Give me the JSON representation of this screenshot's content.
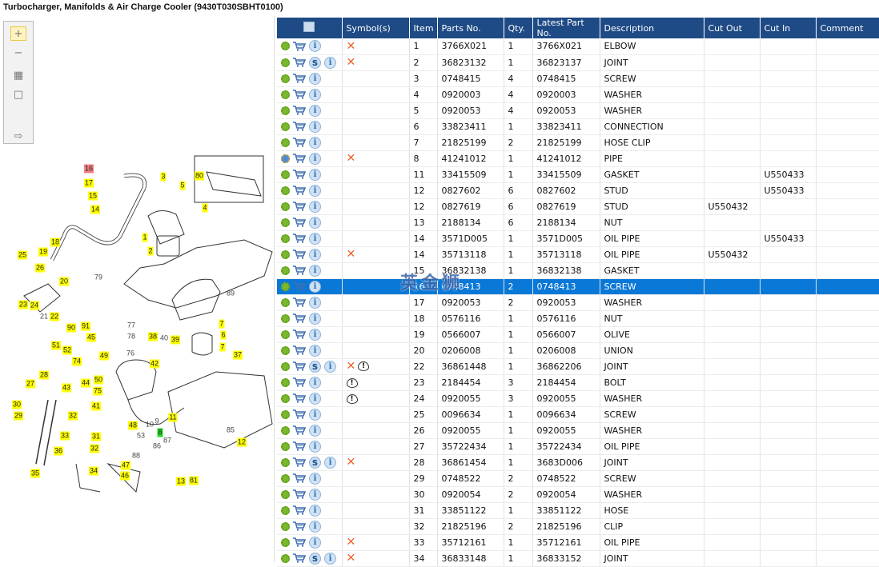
{
  "window": {
    "title": "Turbocharger, Manifolds & Air Charge Cooler (9430T030SBHT0100)"
  },
  "toolbar": {
    "icons": [
      "zoom-in-icon",
      "zoom-out-icon",
      "fit-page-icon",
      "actual-size-icon",
      "toggle-panel-icon"
    ]
  },
  "diagram": {
    "callouts": [
      {
        "t": "16",
        "s": "r"
      },
      {
        "t": "17",
        "s": "y"
      },
      {
        "t": "15",
        "s": "y"
      },
      {
        "t": "14",
        "s": "y"
      },
      {
        "t": "3",
        "s": "y"
      },
      {
        "t": "5",
        "s": "y"
      },
      {
        "t": "4",
        "s": "y"
      },
      {
        "t": "80",
        "s": "y"
      },
      {
        "t": "1",
        "s": "y"
      },
      {
        "t": "2",
        "s": "y"
      },
      {
        "t": "18",
        "s": "y"
      },
      {
        "t": "19",
        "s": "y"
      },
      {
        "t": "25",
        "s": "y"
      },
      {
        "t": "26",
        "s": "y"
      },
      {
        "t": "20",
        "s": "y"
      },
      {
        "t": "79",
        "s": "n"
      },
      {
        "t": "23",
        "s": "y"
      },
      {
        "t": "24",
        "s": "y"
      },
      {
        "t": "21",
        "s": "n"
      },
      {
        "t": "22",
        "s": "y"
      },
      {
        "t": "89",
        "s": "n"
      },
      {
        "t": "90",
        "s": "y"
      },
      {
        "t": "91",
        "s": "y"
      },
      {
        "t": "77",
        "s": "n"
      },
      {
        "t": "78",
        "s": "n"
      },
      {
        "t": "76",
        "s": "n"
      },
      {
        "t": "38",
        "s": "y"
      },
      {
        "t": "40",
        "s": "n"
      },
      {
        "t": "39",
        "s": "y"
      },
      {
        "t": "7",
        "s": "y"
      },
      {
        "t": "6",
        "s": "y"
      },
      {
        "t": "7",
        "s": "y"
      },
      {
        "t": "37",
        "s": "y"
      },
      {
        "t": "51",
        "s": "y"
      },
      {
        "t": "52",
        "s": "y"
      },
      {
        "t": "45",
        "s": "y"
      },
      {
        "t": "74",
        "s": "y"
      },
      {
        "t": "49",
        "s": "y"
      },
      {
        "t": "42",
        "s": "y"
      },
      {
        "t": "28",
        "s": "y"
      },
      {
        "t": "27",
        "s": "y"
      },
      {
        "t": "50",
        "s": "y"
      },
      {
        "t": "44",
        "s": "y"
      },
      {
        "t": "43",
        "s": "y"
      },
      {
        "t": "75",
        "s": "y"
      },
      {
        "t": "30",
        "s": "y"
      },
      {
        "t": "41",
        "s": "y"
      },
      {
        "t": "29",
        "s": "y"
      },
      {
        "t": "11",
        "s": "y"
      },
      {
        "t": "10",
        "s": "n"
      },
      {
        "t": "9",
        "s": "n"
      },
      {
        "t": "48",
        "s": "y"
      },
      {
        "t": "8",
        "s": "g"
      },
      {
        "t": "32",
        "s": "y"
      },
      {
        "t": "31",
        "s": "y"
      },
      {
        "t": "53",
        "s": "n"
      },
      {
        "t": "85",
        "s": "n"
      },
      {
        "t": "87",
        "s": "n"
      },
      {
        "t": "33",
        "s": "y"
      },
      {
        "t": "32",
        "s": "y"
      },
      {
        "t": "86",
        "s": "n"
      },
      {
        "t": "12",
        "s": "y"
      },
      {
        "t": "88",
        "s": "n"
      },
      {
        "t": "36",
        "s": "y"
      },
      {
        "t": "47",
        "s": "y"
      },
      {
        "t": "46",
        "s": "y"
      },
      {
        "t": "35",
        "s": "y"
      },
      {
        "t": "34",
        "s": "y"
      },
      {
        "t": "13",
        "s": "y"
      },
      {
        "t": "81",
        "s": "y"
      }
    ]
  },
  "table": {
    "columns": [
      "",
      "Symbol(s)",
      "Item",
      "Parts No.",
      "Qty.",
      "Latest Part No.",
      "Description",
      "Cut Out",
      "Cut In",
      "Comment"
    ],
    "header_icon": "search-list-icon",
    "selected_row": 15,
    "watermark": "英金狮",
    "rows": [
      {
        "item": "1",
        "part": "3766X021",
        "qty": "1",
        "latest": "3766X021",
        "desc": "ELBOW",
        "out": "",
        "in": "",
        "s": false,
        "x": true,
        "w": false
      },
      {
        "item": "2",
        "part": "36823132",
        "qty": "1",
        "latest": "36823137",
        "desc": "JOINT",
        "out": "",
        "in": "",
        "s": true,
        "x": true,
        "w": false
      },
      {
        "item": "3",
        "part": "0748415",
        "qty": "4",
        "latest": "0748415",
        "desc": "SCREW",
        "out": "",
        "in": "",
        "s": false,
        "x": false,
        "w": false
      },
      {
        "item": "4",
        "part": "0920003",
        "qty": "4",
        "latest": "0920003",
        "desc": "WASHER",
        "out": "",
        "in": "",
        "s": false,
        "x": false,
        "w": false
      },
      {
        "item": "5",
        "part": "0920053",
        "qty": "4",
        "latest": "0920053",
        "desc": "WASHER",
        "out": "",
        "in": "",
        "s": false,
        "x": false,
        "w": false
      },
      {
        "item": "6",
        "part": "33823411",
        "qty": "1",
        "latest": "33823411",
        "desc": "CONNECTION",
        "out": "",
        "in": "",
        "s": false,
        "x": false,
        "w": false
      },
      {
        "item": "7",
        "part": "21825199",
        "qty": "2",
        "latest": "21825199",
        "desc": "HOSE CLIP",
        "out": "",
        "in": "",
        "s": false,
        "x": false,
        "w": false
      },
      {
        "item": "8",
        "part": "41241012",
        "qty": "1",
        "latest": "41241012",
        "desc": "PIPE",
        "out": "",
        "in": "",
        "s": false,
        "x": true,
        "w": false,
        "multi": true
      },
      {
        "item": "11",
        "part": "33415509",
        "qty": "1",
        "latest": "33415509",
        "desc": "GASKET",
        "out": "",
        "in": "U550433",
        "s": false,
        "x": false,
        "w": false
      },
      {
        "item": "12",
        "part": "0827602",
        "qty": "6",
        "latest": "0827602",
        "desc": "STUD",
        "out": "",
        "in": "U550433",
        "s": false,
        "x": false,
        "w": false
      },
      {
        "item": "12",
        "part": "0827619",
        "qty": "6",
        "latest": "0827619",
        "desc": "STUD",
        "out": "U550432",
        "in": "",
        "s": false,
        "x": false,
        "w": false
      },
      {
        "item": "13",
        "part": "2188134",
        "qty": "6",
        "latest": "2188134",
        "desc": "NUT",
        "out": "",
        "in": "",
        "s": false,
        "x": false,
        "w": false
      },
      {
        "item": "14",
        "part": "3571D005",
        "qty": "1",
        "latest": "3571D005",
        "desc": "OIL PIPE",
        "out": "",
        "in": "U550433",
        "s": false,
        "x": false,
        "w": false
      },
      {
        "item": "14",
        "part": "35713118",
        "qty": "1",
        "latest": "35713118",
        "desc": "OIL PIPE",
        "out": "U550432",
        "in": "",
        "s": false,
        "x": true,
        "w": false
      },
      {
        "item": "15",
        "part": "36832138",
        "qty": "1",
        "latest": "36832138",
        "desc": "GASKET",
        "out": "",
        "in": "",
        "s": false,
        "x": false,
        "w": false
      },
      {
        "item": "16",
        "part": "0748413",
        "qty": "2",
        "latest": "0748413",
        "desc": "SCREW",
        "out": "",
        "in": "",
        "s": false,
        "x": false,
        "w": false
      },
      {
        "item": "17",
        "part": "0920053",
        "qty": "2",
        "latest": "0920053",
        "desc": "WASHER",
        "out": "",
        "in": "",
        "s": false,
        "x": false,
        "w": false
      },
      {
        "item": "18",
        "part": "0576116",
        "qty": "1",
        "latest": "0576116",
        "desc": "NUT",
        "out": "",
        "in": "",
        "s": false,
        "x": false,
        "w": false
      },
      {
        "item": "19",
        "part": "0566007",
        "qty": "1",
        "latest": "0566007",
        "desc": "OLIVE",
        "out": "",
        "in": "",
        "s": false,
        "x": false,
        "w": false
      },
      {
        "item": "20",
        "part": "0206008",
        "qty": "1",
        "latest": "0206008",
        "desc": "UNION",
        "out": "",
        "in": "",
        "s": false,
        "x": false,
        "w": false
      },
      {
        "item": "22",
        "part": "36861448",
        "qty": "1",
        "latest": "36862206",
        "desc": "JOINT",
        "out": "",
        "in": "",
        "s": true,
        "x": true,
        "w": true
      },
      {
        "item": "23",
        "part": "2184454",
        "qty": "3",
        "latest": "2184454",
        "desc": "BOLT",
        "out": "",
        "in": "",
        "s": false,
        "x": false,
        "w": true
      },
      {
        "item": "24",
        "part": "0920055",
        "qty": "3",
        "latest": "0920055",
        "desc": "WASHER",
        "out": "",
        "in": "",
        "s": false,
        "x": false,
        "w": true
      },
      {
        "item": "25",
        "part": "0096634",
        "qty": "1",
        "latest": "0096634",
        "desc": "SCREW",
        "out": "",
        "in": "",
        "s": false,
        "x": false,
        "w": false
      },
      {
        "item": "26",
        "part": "0920055",
        "qty": "1",
        "latest": "0920055",
        "desc": "WASHER",
        "out": "",
        "in": "",
        "s": false,
        "x": false,
        "w": false
      },
      {
        "item": "27",
        "part": "35722434",
        "qty": "1",
        "latest": "35722434",
        "desc": "OIL PIPE",
        "out": "",
        "in": "",
        "s": false,
        "x": false,
        "w": false
      },
      {
        "item": "28",
        "part": "36861454",
        "qty": "1",
        "latest": "3683D006",
        "desc": "JOINT",
        "out": "",
        "in": "",
        "s": true,
        "x": true,
        "w": false
      },
      {
        "item": "29",
        "part": "0748522",
        "qty": "2",
        "latest": "0748522",
        "desc": "SCREW",
        "out": "",
        "in": "",
        "s": false,
        "x": false,
        "w": false
      },
      {
        "item": "30",
        "part": "0920054",
        "qty": "2",
        "latest": "0920054",
        "desc": "WASHER",
        "out": "",
        "in": "",
        "s": false,
        "x": false,
        "w": false
      },
      {
        "item": "31",
        "part": "33851122",
        "qty": "1",
        "latest": "33851122",
        "desc": "HOSE",
        "out": "",
        "in": "",
        "s": false,
        "x": false,
        "w": false
      },
      {
        "item": "32",
        "part": "21825196",
        "qty": "2",
        "latest": "21825196",
        "desc": "CLIP",
        "out": "",
        "in": "",
        "s": false,
        "x": false,
        "w": false
      },
      {
        "item": "33",
        "part": "35712161",
        "qty": "1",
        "latest": "35712161",
        "desc": "OIL PIPE",
        "out": "",
        "in": "",
        "s": false,
        "x": true,
        "w": false
      },
      {
        "item": "34",
        "part": "36833148",
        "qty": "1",
        "latest": "36833152",
        "desc": "JOINT",
        "out": "",
        "in": "",
        "s": true,
        "x": true,
        "w": false
      }
    ]
  },
  "colors": {
    "header": "#1e4a85",
    "selected": "#0a78d7",
    "symbol_x": "#f0602a",
    "callout": "#ffff00",
    "callout_current": "#f08080",
    "callout_green": "#22dd22"
  }
}
